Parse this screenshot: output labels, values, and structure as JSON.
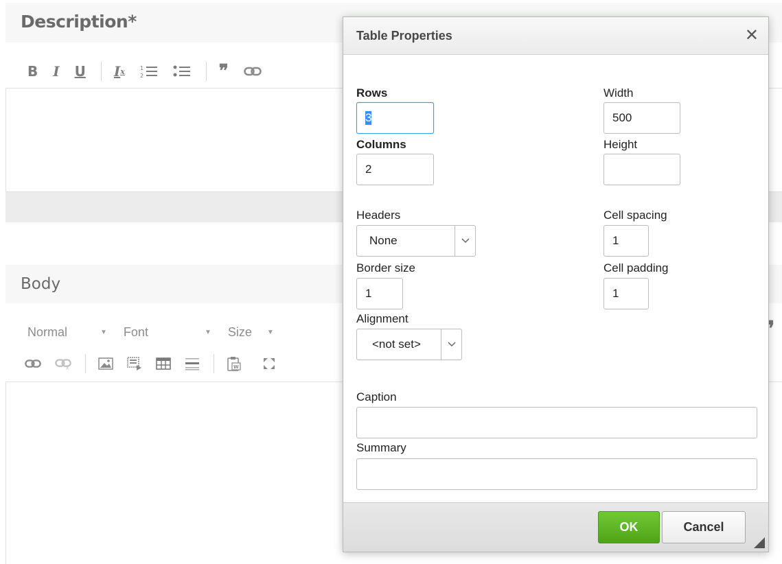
{
  "page": {
    "description_label": "Description*",
    "body_label": "Body",
    "toolbar1": {
      "bold": "B",
      "italic": "I",
      "underline": "U",
      "remove_format": "Tx",
      "numbered_list": "1≡",
      "bulleted_list": "•≡",
      "blockquote": "99",
      "link": "⊂⊃"
    },
    "toolbar2": {
      "format": "Normal",
      "font": "Font",
      "size": "Size",
      "quote_right": "99"
    }
  },
  "dialog": {
    "title": "Table Properties",
    "close_glyph": "✕",
    "rows": {
      "label": "Rows",
      "value": "3"
    },
    "columns": {
      "label": "Columns",
      "value": "2"
    },
    "width": {
      "label": "Width",
      "value": "500"
    },
    "height": {
      "label": "Height",
      "value": ""
    },
    "headers": {
      "label": "Headers",
      "value": "None"
    },
    "cell_spacing": {
      "label": "Cell spacing",
      "value": "1"
    },
    "border_size": {
      "label": "Border size",
      "value": "1"
    },
    "cell_padding": {
      "label": "Cell padding",
      "value": "1"
    },
    "alignment": {
      "label": "Alignment",
      "value": "<not set>"
    },
    "caption": {
      "label": "Caption",
      "value": ""
    },
    "summary": {
      "label": "Summary",
      "value": ""
    },
    "ok_label": "OK",
    "cancel_label": "Cancel"
  }
}
